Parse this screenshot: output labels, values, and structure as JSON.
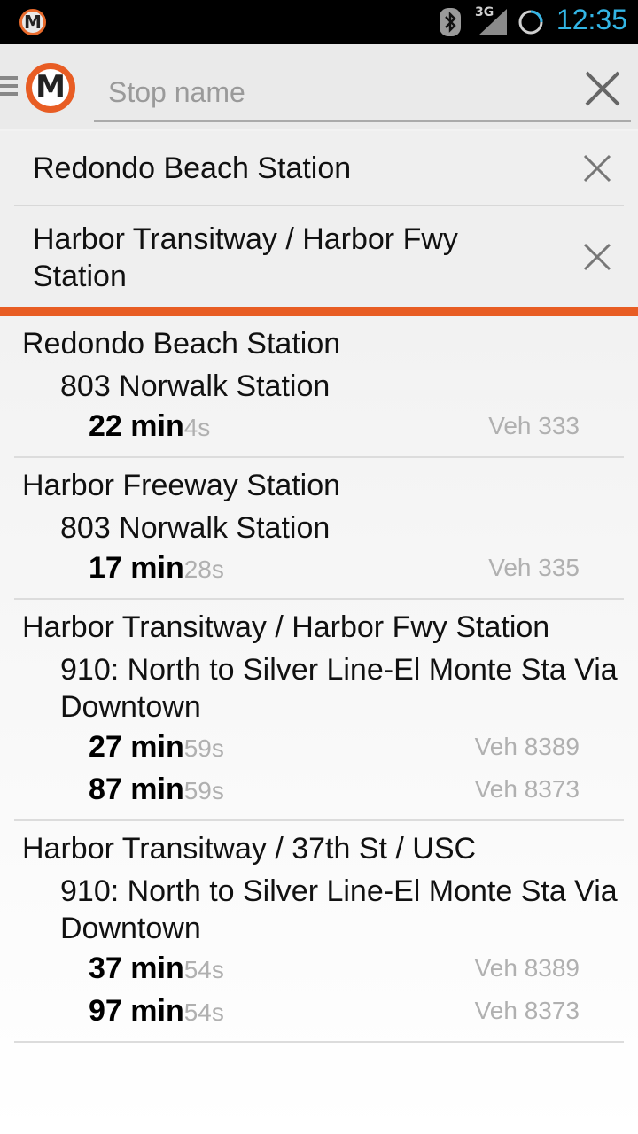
{
  "status_bar": {
    "time": "12:35",
    "network_label": "3G",
    "app_logo_letter": "M",
    "icons": [
      "app-logo-icon",
      "bluetooth-icon",
      "signal-3g-icon",
      "sync-icon"
    ],
    "accent_color": "#33b5e5"
  },
  "action_bar": {
    "logo_letter": "M",
    "search": {
      "placeholder": "Stop name",
      "value": ""
    },
    "icons": [
      "menu-icon",
      "metro-logo-icon",
      "clear-search-icon"
    ]
  },
  "selected_stops": [
    {
      "label": "Redondo Beach Station"
    },
    {
      "label": "Harbor Transitway / Harbor Fwy Station"
    }
  ],
  "brand_color": "#e85d24",
  "arrivals": [
    {
      "stop": "Redondo Beach Station",
      "route": "803 Norwalk Station",
      "times": [
        {
          "min": "22 min",
          "sec": "4s",
          "veh": "Veh 333"
        }
      ]
    },
    {
      "stop": "Harbor Freeway Station",
      "route": "803 Norwalk Station",
      "times": [
        {
          "min": "17 min",
          "sec": "28s",
          "veh": "Veh 335"
        }
      ]
    },
    {
      "stop": "Harbor Transitway / Harbor Fwy Station",
      "route": "910: North to Silver Line-El Monte Sta Via Downtown",
      "times": [
        {
          "min": "27 min",
          "sec": "59s",
          "veh": "Veh 8389"
        },
        {
          "min": "87 min",
          "sec": "59s",
          "veh": "Veh 8373"
        }
      ]
    },
    {
      "stop": "Harbor Transitway / 37th St / USC",
      "route": "910: North to Silver Line-El Monte Sta Via Downtown",
      "times": [
        {
          "min": "37 min",
          "sec": "54s",
          "veh": "Veh 8389"
        },
        {
          "min": "97 min",
          "sec": "54s",
          "veh": "Veh 8373"
        }
      ]
    }
  ]
}
